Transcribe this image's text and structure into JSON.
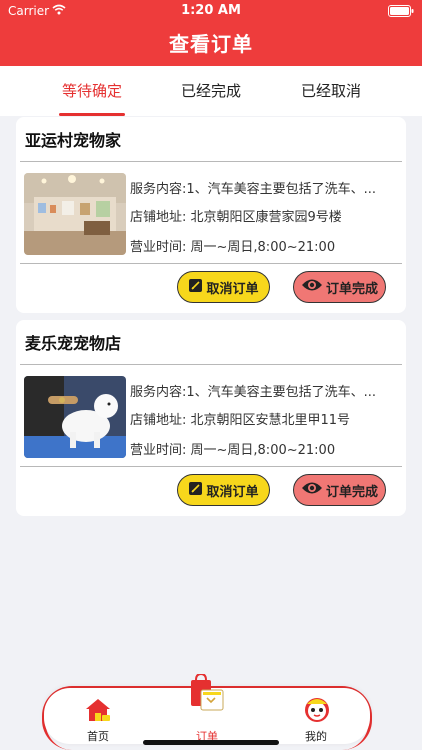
{
  "status_bar": {
    "carrier": "Carrier",
    "time": "1:20 AM"
  },
  "header": {
    "title": "查看订单"
  },
  "tabs": [
    {
      "label": "等待确定",
      "active": true
    },
    {
      "label": "已经完成",
      "active": false
    },
    {
      "label": "已经取消",
      "active": false
    }
  ],
  "orders": [
    {
      "shop_name": "亚运村宠物家",
      "service": "服务内容:1、汽车美容主要包括了洗车、...",
      "address": "店铺地址: 北京朝阳区康营家园9号楼",
      "hours": "营业时间: 周一~周日,8:00~21:00",
      "cancel_label": "取消订单",
      "complete_label": "订单完成"
    },
    {
      "shop_name": "麦乐宠宠物店",
      "service": "服务内容:1、汽车美容主要包括了洗车、...",
      "address": "店铺地址: 北京朝阳区安慧北里甲11号",
      "hours": "营业时间: 周一~周日,8:00~21:00",
      "cancel_label": "取消订单",
      "complete_label": "订单完成"
    }
  ],
  "tab_bar": [
    {
      "label": "首页",
      "icon": "home-icon",
      "active": false
    },
    {
      "label": "订单",
      "icon": "order-bag-icon",
      "active": true
    },
    {
      "label": "我的",
      "icon": "profile-mascot-icon",
      "active": false
    }
  ],
  "colors": {
    "primary": "#ee3c3c",
    "cancel_button": "#f7d71c",
    "complete_button": "#f07774",
    "background": "#f1f2f6"
  }
}
